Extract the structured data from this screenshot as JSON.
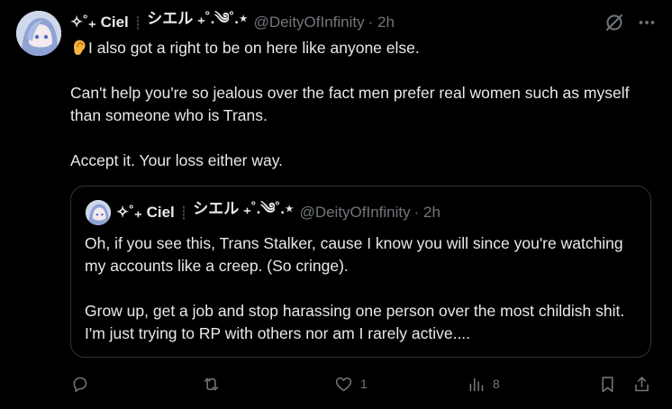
{
  "post": {
    "display_name": "✧˚₊ Ciel",
    "name_suffix": "シエル ₊˚.༄˚.⋆",
    "handle": "@DeityOfInfinity",
    "time": "· 2h",
    "paragraphs": [
      "I also got a right to be on here like anyone else.",
      "Can't help you're so jealous over the fact men prefer real women such as myself than someone who is Trans.",
      "Accept it. Your loss either way."
    ],
    "emoji": "ear-emoji"
  },
  "quoted": {
    "display_name": "✧˚₊ Ciel",
    "name_suffix": "シエル ₊˚.༄˚.⋆",
    "handle": "@DeityOfInfinity",
    "time": "· 2h",
    "paragraphs": [
      "Oh, if you see this, Trans Stalker, cause I know you will since you're watching my accounts like a creep. (So cringe).",
      "Grow up, get a job and stop harassing one person over the most childish shit. I'm just trying to RP with others nor am I rarely active...."
    ]
  },
  "actions": {
    "reply_count": "",
    "repost_count": "",
    "like_count": "1",
    "views_count": "8"
  },
  "colors": {
    "background": "#000000",
    "text": "#e7e9ea",
    "muted": "#71767b",
    "border": "#2f3336"
  }
}
